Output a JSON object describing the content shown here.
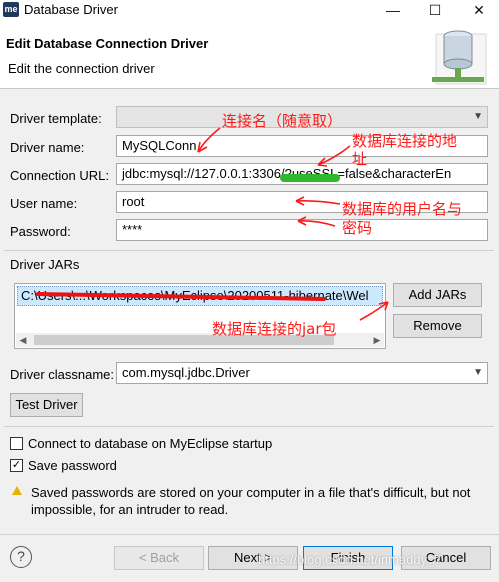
{
  "window": {
    "logo": "me",
    "title": "Database Driver",
    "minimize_glyph": "—",
    "maximize_glyph": "☐",
    "close_glyph": "✕"
  },
  "header": {
    "title": "Edit Database Connection Driver",
    "subtitle": "Edit the connection driver"
  },
  "form": {
    "driver_template_label": "Driver template:",
    "driver_template_value": "",
    "driver_name_label": "Driver name:",
    "driver_name_value": "MySQLConn",
    "connection_url_label": "Connection URL:",
    "connection_url_value": "jdbc:mysql://127.0.0.1:3306/?useSSL=false&characterEn",
    "user_name_label": "User name:",
    "user_name_value": "root",
    "password_label": "Password:",
    "password_value": "****"
  },
  "jars": {
    "section_label": "Driver JARs",
    "entry": "C:\\Users\\...\\Workspaces\\MyEclipse\\20200511-hibernate\\Wel",
    "add_button": "Add JARs",
    "remove_button": "Remove"
  },
  "classname": {
    "label": "Driver classname:",
    "value": "com.mysql.jdbc.Driver"
  },
  "test_button": "Test Driver",
  "options": {
    "connect_startup_label": "Connect to database on MyEclipse startup",
    "connect_startup_checked": false,
    "save_password_label": "Save password",
    "save_password_checked": true
  },
  "warning": "Saved passwords are stored on your computer in a file that's difficult, but not impossible, for an intruder to read.",
  "footer": {
    "help": "?",
    "back_button": "< Back",
    "next_button": "Next >",
    "finish_button": "Finish",
    "cancel_button": "Cancel"
  },
  "annotations": {
    "connection_name_note": "连接名（随意取）",
    "db_address_note_line1": "数据库连接的地",
    "db_address_note_line2": "址",
    "credentials_note_line1": "数据库的用户名与",
    "credentials_note_line2": "密码",
    "jar_note": "数据库连接的jar包"
  },
  "watermark": "https://blog.csdn.net/inmaddy_7",
  "colors": {
    "annotation_red": "#ff1a1a",
    "selection_blue": "#cce8ff",
    "primary_border": "#0078d7"
  }
}
